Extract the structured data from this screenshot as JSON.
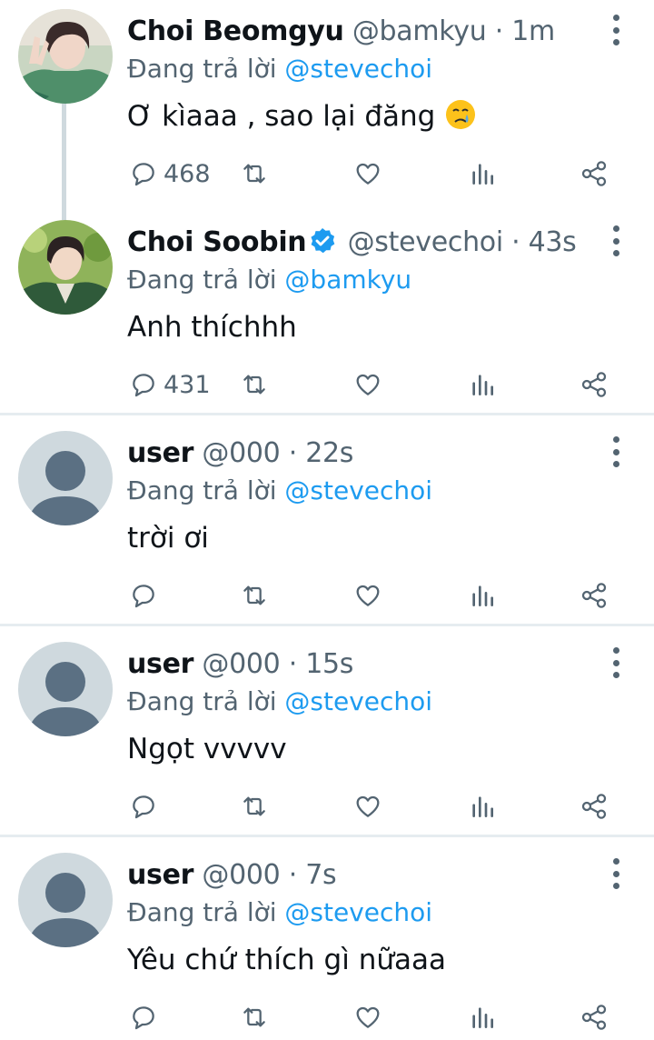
{
  "tweets": [
    {
      "name": "Choi Beomgyu",
      "handle": "@bamkyu",
      "time": "· 1m",
      "reply_prefix": "Đang trả lời",
      "reply_to": "@stevechoi",
      "text": "Ơ kìaaa , sao lại đăng",
      "emoji": "crying-face-emoji",
      "replies": "468",
      "verified": false
    },
    {
      "name": "Choi Soobin",
      "handle": "@stevechoi",
      "time": "· 43s",
      "reply_prefix": "Đang trả lời",
      "reply_to": "@bamkyu",
      "text": "Anh thíchhh",
      "replies": "431",
      "verified": true
    },
    {
      "name": "user",
      "handle": "@000",
      "time": "· 22s",
      "reply_prefix": "Đang trả lời",
      "reply_to": "@stevechoi",
      "text": "trời ơi",
      "replies": ""
    },
    {
      "name": "user",
      "handle": "@000",
      "time": "· 15s",
      "reply_prefix": "Đang trả lời",
      "reply_to": "@stevechoi",
      "text": "Ngọt vvvvv",
      "replies": ""
    },
    {
      "name": "user",
      "handle": "@000",
      "time": "· 7s",
      "reply_prefix": "Đang trả lời",
      "reply_to": "@stevechoi",
      "text": "Yêu chứ thích gì nữaaa",
      "replies": ""
    }
  ],
  "colors": {
    "link": "#1d9bf0",
    "muted": "#536471",
    "divider": "#e6ecf0",
    "thread_line": "#cfd9de"
  },
  "icons": [
    "reply-icon",
    "retweet-icon",
    "like-icon",
    "analytics-icon",
    "share-icon",
    "more-options-icon",
    "verified-badge-icon"
  ]
}
